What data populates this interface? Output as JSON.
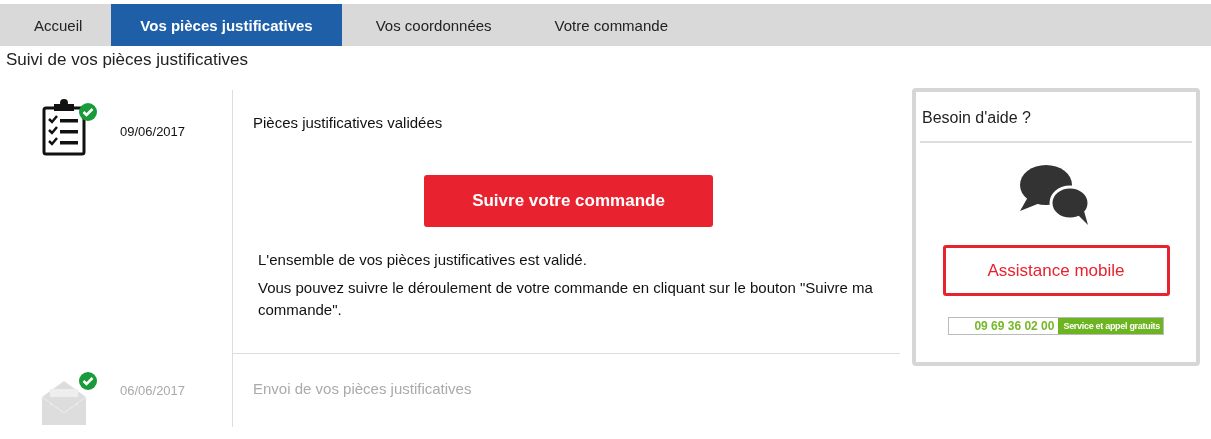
{
  "tabs": [
    {
      "label": "Accueil",
      "selected": false
    },
    {
      "label": "Vos pièces justificatives",
      "selected": true
    },
    {
      "label": "Vos coordonnées",
      "selected": false
    },
    {
      "label": "Votre commande",
      "selected": false
    }
  ],
  "heading": "Suivi de vos pièces justificatives",
  "steps": [
    {
      "kind": "clipboard",
      "completed": true,
      "active": true,
      "date": "09/06/2017",
      "title": "Pièces justificatives validées",
      "button": "Suivre votre commande",
      "paragraphs": [
        "L'ensemble de vos pièces justificatives est validé.",
        "Vous pouvez suivre le déroulement de votre commande en cliquant sur le bouton \"Suivre ma commande\"."
      ]
    },
    {
      "kind": "envelope",
      "completed": true,
      "active": false,
      "date": "06/06/2017",
      "title": "Envoi de vos pièces justificatives"
    }
  ],
  "help": {
    "title": "Besoin d'aide ?",
    "button": "Assistance mobile",
    "phone": "09 69 36 02 00",
    "phone_note": "Service et appel gratuits"
  }
}
